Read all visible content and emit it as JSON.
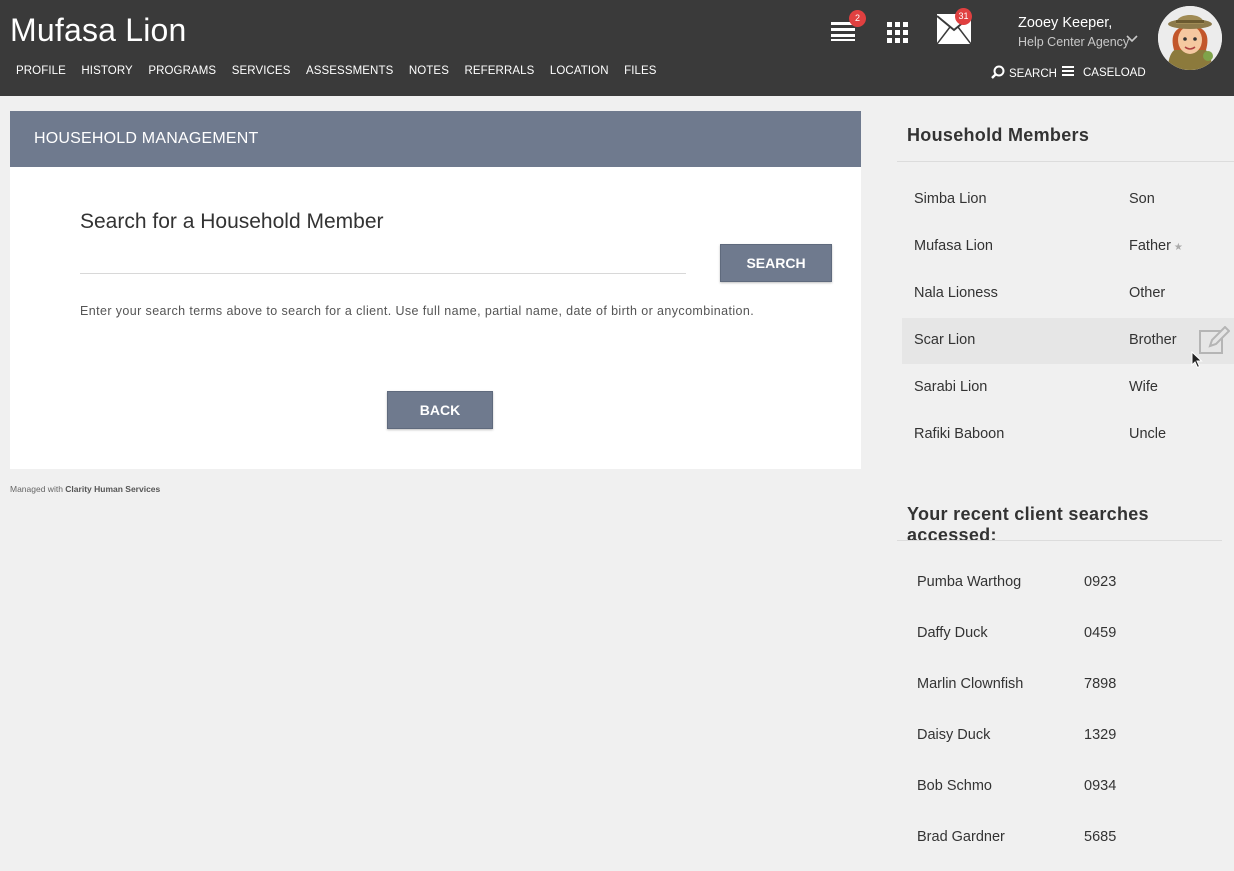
{
  "header": {
    "client_name": "Mufasa Lion",
    "nav": [
      "PROFILE",
      "HISTORY",
      "PROGRAMS",
      "SERVICES",
      "ASSESSMENTS",
      "NOTES",
      "REFERRALS",
      "LOCATION",
      "FILES"
    ],
    "queue_badge": "2",
    "messages_badge": "31",
    "user_name": "Zooey Keeper,",
    "user_agency": "Help Center Agency",
    "search_label": "SEARCH",
    "caseload_label": "CASELOAD",
    "icons": [
      "queue-icon",
      "apps-grid-icon",
      "mail-icon",
      "chevron-down-icon",
      "search-icon",
      "menu-icon"
    ]
  },
  "panel": {
    "title": "HOUSEHOLD MANAGEMENT",
    "search_title": "Search for a Household Member",
    "search_value": "",
    "search_button": "SEARCH",
    "helper": "Enter your search terms above to search for a client. Use full name, partial name, date of birth or anycombination.",
    "back_button": "BACK"
  },
  "footer": {
    "prefix": "Managed with",
    "brand": "Clarity Human Services"
  },
  "household": {
    "title": "Household Members",
    "members": [
      {
        "name": "Simba Lion",
        "relation": "Son"
      },
      {
        "name": "Mufasa Lion",
        "relation": "Father",
        "head": true
      },
      {
        "name": "Nala Lioness",
        "relation": "Other"
      },
      {
        "name": "Scar Lion",
        "relation": "Brother",
        "highlighted": true
      },
      {
        "name": "Sarabi Lion",
        "relation": "Wife"
      },
      {
        "name": "Rafiki Baboon",
        "relation": "Uncle"
      }
    ]
  },
  "recent": {
    "title": "Your recent client searches accessed:",
    "items": [
      {
        "name": "Pumba Warthog",
        "id": "0923"
      },
      {
        "name": "Daffy Duck",
        "id": "0459"
      },
      {
        "name": "Marlin Clownfish",
        "id": "7898"
      },
      {
        "name": "Daisy Duck",
        "id": "1329"
      },
      {
        "name": "Bob Schmo",
        "id": "0934"
      },
      {
        "name": "Brad Gardner",
        "id": "5685"
      }
    ]
  },
  "colors": {
    "header_bg": "#3a3a3a",
    "panel_head": "#6f7a8e",
    "badge": "#e04040"
  }
}
